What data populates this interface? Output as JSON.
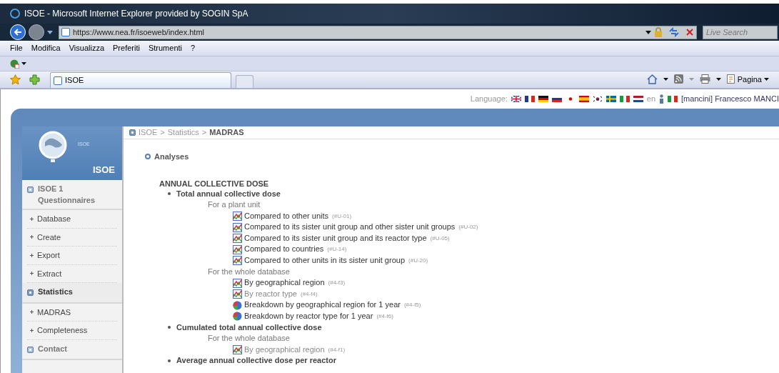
{
  "browser": {
    "title": "ISOE - Microsoft Internet Explorer provided by SOGIN SpA",
    "url": "https://www.nea.fr/isoeweb/index.html",
    "search_placeholder": "Live Search",
    "menu": [
      "File",
      "Modifica",
      "Visualizza",
      "Preferiti",
      "Strumenti",
      "?"
    ],
    "tab_title": "ISOE",
    "page_button": "Pagina"
  },
  "header": {
    "language_label": "Language:",
    "languages": [
      {
        "kind": "gb"
      },
      {
        "kind": "fr"
      },
      {
        "kind": "de"
      },
      {
        "kind": "ru"
      },
      {
        "kind": "jp"
      },
      {
        "kind": "es"
      },
      {
        "kind": "kr"
      },
      {
        "kind": "se"
      },
      {
        "kind": "it"
      },
      {
        "kind": "nl"
      }
    ],
    "current_language": "en",
    "user_flag": {
      "kind": "it"
    },
    "user": "[mancini] Francesco MANCI"
  },
  "sidebar": {
    "logo_caption": "ISOE",
    "title": "ISOE",
    "sections": [
      {
        "label": "ISOE 1 Questionnaires",
        "selected": false,
        "children": [
          {
            "label": "Database"
          },
          {
            "label": "Create"
          },
          {
            "label": "Export"
          },
          {
            "label": "Extract"
          }
        ]
      },
      {
        "label": "Statistics",
        "selected": true,
        "children": [
          {
            "label": "MADRAS"
          },
          {
            "label": "Completeness"
          }
        ]
      },
      {
        "label": "Contact",
        "selected": false
      }
    ]
  },
  "breadcrumb": {
    "separator": ">",
    "items": [
      "ISOE",
      "Statistics",
      "MADRAS"
    ]
  },
  "heading": "Analyses",
  "section_title": "ANNUAL COLLECTIVE DOSE",
  "topics": [
    {
      "label": "Total annual collective dose",
      "children": [
        {
          "label": "For a plant unit",
          "children": [
            {
              "label": "Compared to other units",
              "code": "(#U-01)",
              "kind": "line",
              "disabled": false
            },
            {
              "label": "Compared to its sister unit group and other sister unit groups",
              "code": "(#U-02)",
              "kind": "line",
              "disabled": false
            },
            {
              "label": "Compared to its sister unit group and its reactor type",
              "code": "(#U-05)",
              "kind": "line",
              "disabled": false
            },
            {
              "label": "Compared to countries",
              "code": "(#U-14)",
              "kind": "line",
              "disabled": false
            },
            {
              "label": "Compared to other units in its sister unit group",
              "code": "(#U-20)",
              "kind": "line",
              "disabled": false
            }
          ]
        },
        {
          "label": "For the whole database",
          "children": [
            {
              "label": "By geographical region",
              "code": "(#4-f3)",
              "kind": "line",
              "disabled": false
            },
            {
              "label": "By reactor type",
              "code": "(#4-f4)",
              "kind": "line",
              "disabled": true
            },
            {
              "label": "Breakdown by geographical region for 1 year",
              "code": "(#4-f5)",
              "kind": "pie",
              "disabled": false
            },
            {
              "label": "Breakdown by reactor type for 1 year",
              "code": "(#4-f6)",
              "kind": "pie",
              "disabled": false
            }
          ]
        }
      ]
    },
    {
      "label": "Cumulated total annual collective dose",
      "children": [
        {
          "label": "For the whole database",
          "children": [
            {
              "label": "By geographical region",
              "code": "(#4-f1)",
              "kind": "line",
              "disabled": true
            }
          ]
        }
      ]
    },
    {
      "label": "Average annual collective dose per reactor"
    }
  ]
}
